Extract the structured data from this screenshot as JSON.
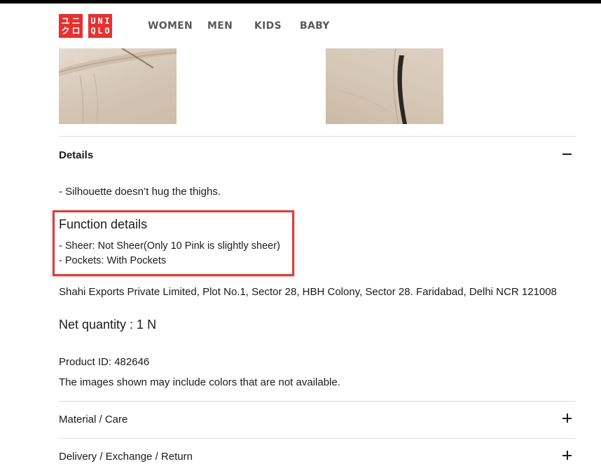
{
  "brand": {
    "logo_chars": [
      "ユ",
      "ニ",
      "ク",
      "ロ",
      "U",
      "N",
      "I",
      "Q",
      "L",
      "O"
    ],
    "color": "#e8302f"
  },
  "nav": {
    "items": [
      "WOMEN",
      "MEN",
      "KIDS",
      "BABY"
    ]
  },
  "details": {
    "title": "Details",
    "toggle_icon": "minus-icon",
    "silhouette": "- Silhouette doesn’t hug the thighs.",
    "function_title": "Function details",
    "function_items": [
      "- Sheer: Not Sheer(Only 10 Pink is slightly sheer)",
      "- Pockets: With Pockets"
    ],
    "manufacturer": "Shahi Exports Private Limited, Plot No.1, Sector 28, HBH Colony, Sector 28. Faridabad, Delhi NCR 121008",
    "net_quantity": "Net quantity : 1 N",
    "product_id": "Product ID: 482646",
    "image_note": "The images shown may include colors that are not available."
  },
  "accordions": [
    {
      "label": "Material / Care",
      "icon": "plus-icon"
    },
    {
      "label": "Delivery / Exchange / Return",
      "icon": "plus-icon"
    }
  ],
  "highlight_color": "#e23b36"
}
